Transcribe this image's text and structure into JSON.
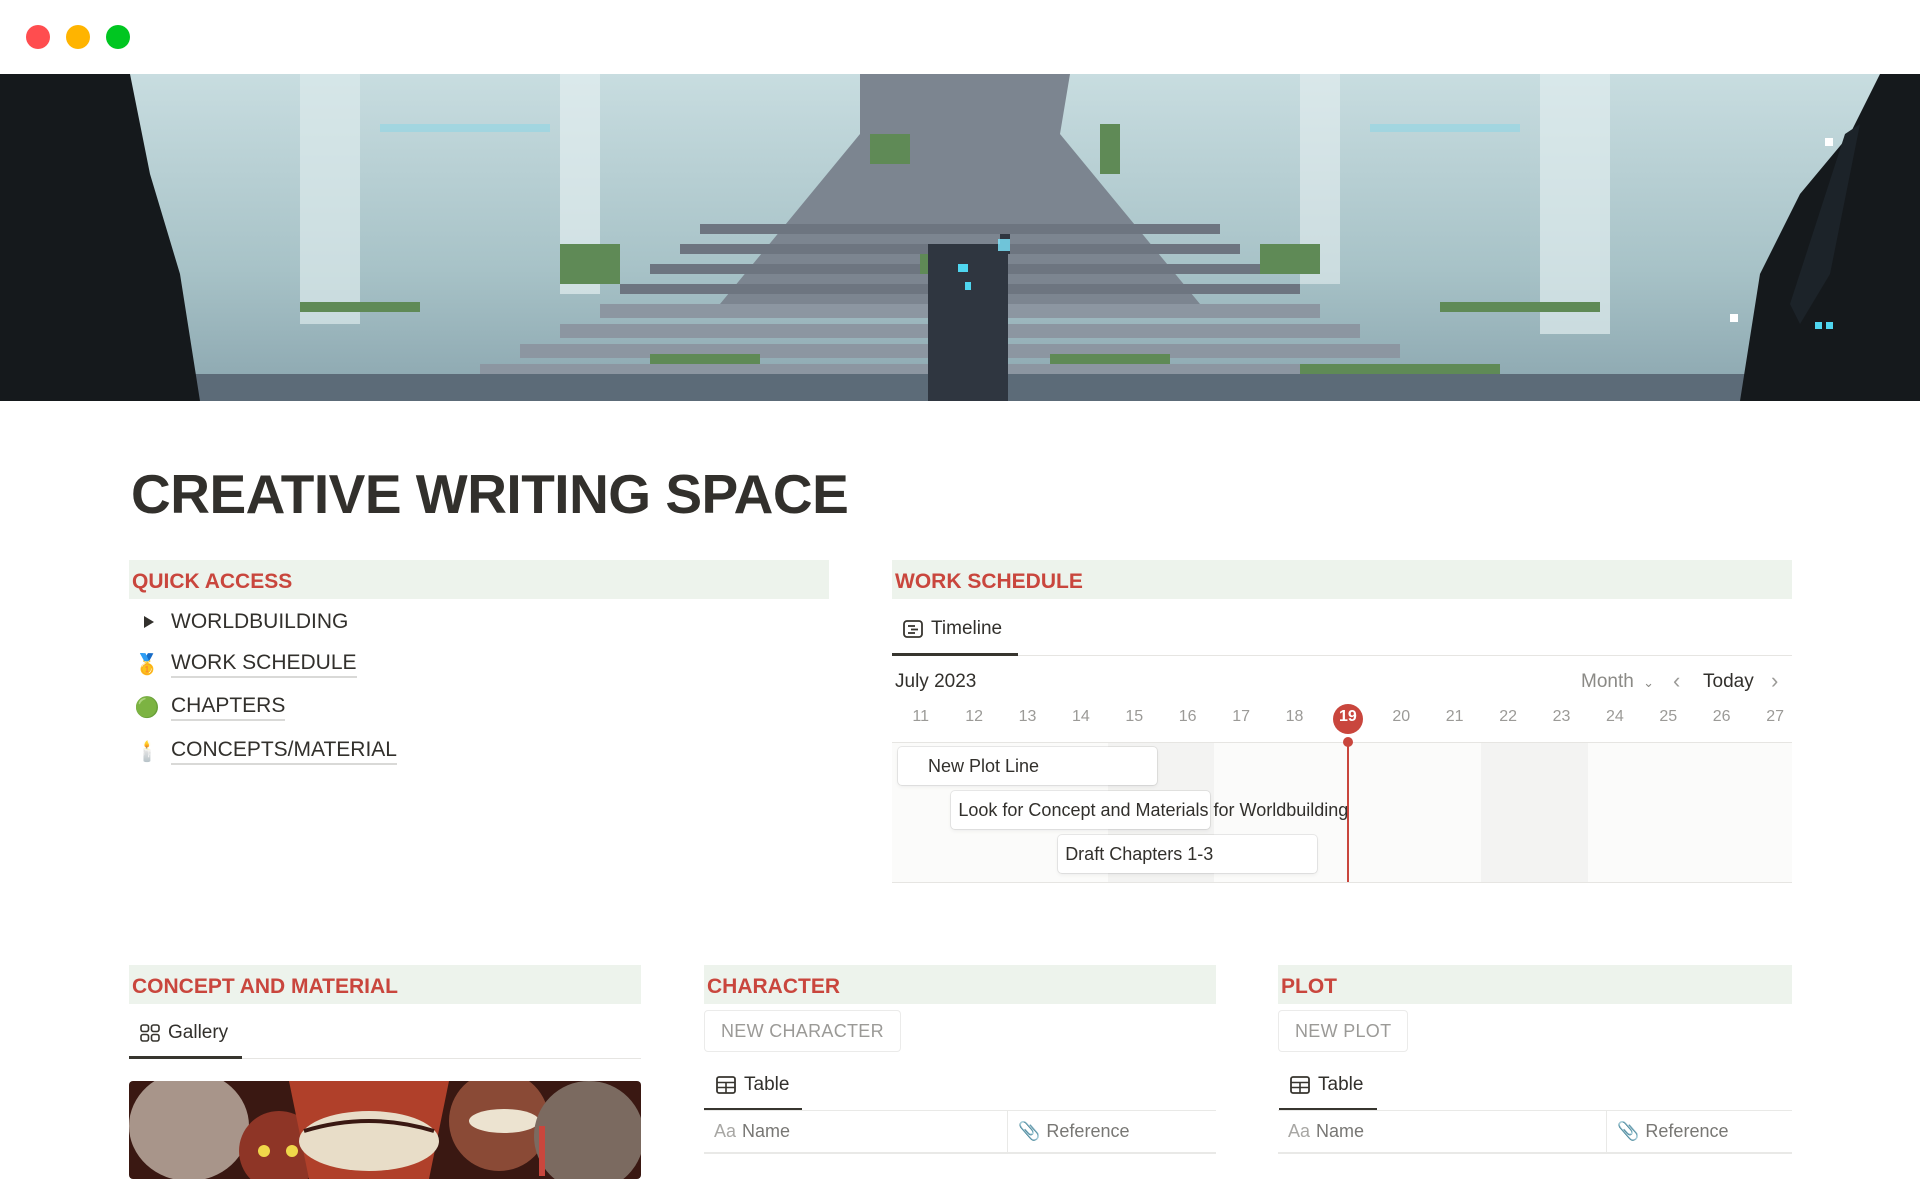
{
  "window": {
    "controls": [
      "close",
      "minimize",
      "maximize"
    ]
  },
  "banner": {
    "description": "pixel-art misty forest temple with staircase and hooded figure"
  },
  "page": {
    "title": "CREATIVE WRITING SPACE"
  },
  "quick_access": {
    "header": "QUICK ACCESS",
    "items": [
      {
        "icon": "toggle-triangle-icon",
        "glyph": "",
        "label": "WORLDBUILDING",
        "linked": false
      },
      {
        "icon": "medal-icon",
        "glyph": "🥇",
        "label": "WORK SCHEDULE",
        "linked": true
      },
      {
        "icon": "green-ball-icon",
        "glyph": "🟢",
        "label": "CHAPTERS",
        "linked": true
      },
      {
        "icon": "candle-icon",
        "glyph": "🕯️",
        "label": "CONCEPTS/MATERIAL",
        "linked": true
      }
    ]
  },
  "work_schedule": {
    "header": "WORK SCHEDULE",
    "view_tab": "Timeline",
    "month_label": "July 2023",
    "view_mode": "Month",
    "today_label": "Today",
    "prev_icon": "‹",
    "next_icon": "›",
    "days": [
      11,
      12,
      13,
      14,
      15,
      16,
      17,
      18,
      19,
      20,
      21,
      22,
      23,
      24,
      25,
      26,
      27
    ],
    "today": 19,
    "weekends": [
      [
        15,
        16
      ],
      [
        22,
        23
      ]
    ],
    "items": [
      {
        "name": "New Plot Line",
        "start": 11,
        "end": 15
      },
      {
        "name": "Look for Concept and Materials for Worldbuilding",
        "start": 12,
        "end": 16
      },
      {
        "name": "Draft Chapters 1-3",
        "start": 14,
        "end": 18
      }
    ],
    "accent_color": "#c9463d"
  },
  "concept_material": {
    "header": "CONCEPT AND MATERIAL",
    "view_tab": "Gallery",
    "card_image": "dark illustration of grinning demon faces"
  },
  "character": {
    "header": "CHARACTER",
    "new_button": "NEW CHARACTER",
    "view_tab": "Table",
    "columns": [
      {
        "icon": "Aa",
        "label": "Name"
      },
      {
        "icon": "paperclip-icon",
        "label": "Reference"
      }
    ]
  },
  "plot": {
    "header": "PLOT",
    "new_button": "NEW PLOT",
    "view_tab": "Table",
    "columns": [
      {
        "icon": "Aa",
        "label": "Name"
      },
      {
        "icon": "paperclip-icon",
        "label": "Reference"
      }
    ]
  },
  "colors": {
    "section_header_bg": "#edf3ec",
    "section_header_text": "#c9463d",
    "text": "#32302c"
  }
}
